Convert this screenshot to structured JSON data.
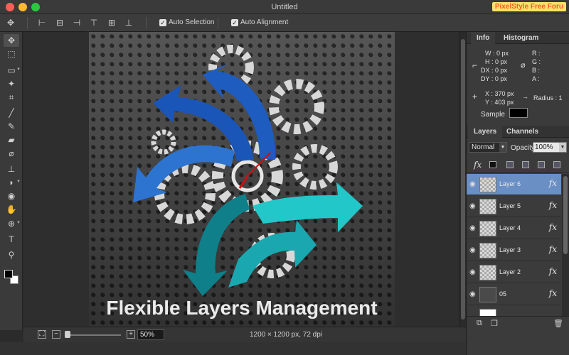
{
  "window": {
    "title": "Untitled",
    "badge": "PixelStyle Free Foru"
  },
  "toolbar": {
    "tool_icon": "move-tool-icon",
    "align_buttons": [
      "align-left-icon",
      "align-center-h-icon",
      "align-right-icon",
      "align-top-icon",
      "align-center-v-icon",
      "align-bottom-icon"
    ],
    "auto_selection": {
      "label": "Auto Selection",
      "checked": true
    },
    "auto_alignment": {
      "label": "Auto Alignment",
      "checked": true
    }
  },
  "tools": [
    "move-tool",
    "transform-tool",
    "marquee-tool",
    "magic-wand-tool",
    "crop-tool",
    "brush-tool",
    "pencil-tool",
    "eraser-tool",
    "eyedropper-tool",
    "stamp-tool",
    "bucket-tool",
    "red-eye-tool",
    "hand-tool",
    "zoom-tool",
    "text-tool",
    "magnifier-tool"
  ],
  "canvas": {
    "caption": "Flexible Layers Management"
  },
  "status": {
    "zoom": "50%",
    "dimensions": "1200 × 1200 px, 72 dpi"
  },
  "info_panel": {
    "tabs": [
      "Info",
      "Histogram"
    ],
    "w": "W : 0 px",
    "h": "H : 0 px",
    "dx": "DX : 0 px",
    "dy": "DY : 0 px",
    "r": "R :",
    "g": "G :",
    "b": "B :",
    "a": "A :",
    "x": "X : 370 px",
    "y": "Y : 403 px",
    "radius": "Radius : 1",
    "sample_label": "Sample"
  },
  "layers_panel": {
    "tabs": [
      "Layers",
      "Channels"
    ],
    "blend_mode": "Normal",
    "opacity_label": "Opacity",
    "opacity_value": "100%",
    "fx_label": "fx",
    "layers": [
      {
        "name": "Layer 6",
        "selected": true
      },
      {
        "name": "Layer 5",
        "selected": false
      },
      {
        "name": "Layer 4",
        "selected": false
      },
      {
        "name": "Layer 3",
        "selected": false
      },
      {
        "name": "Layer 2",
        "selected": false
      },
      {
        "name": "05",
        "selected": false
      }
    ]
  }
}
